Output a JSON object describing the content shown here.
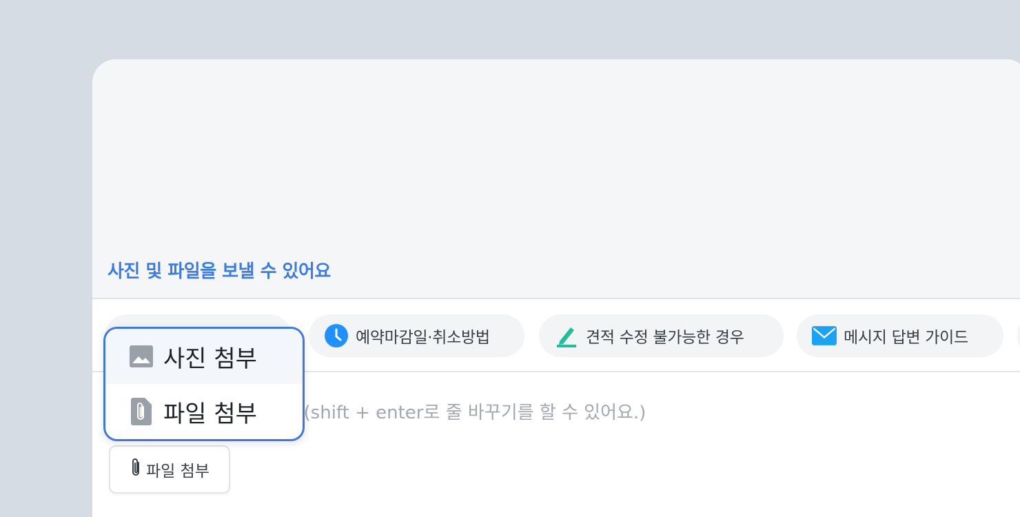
{
  "preview": {
    "hint": "사진 및 파일을 보낼 수 있어요"
  },
  "chips": [
    {
      "label": "",
      "icon": "hidden-icon"
    },
    {
      "label": "예약마감일·취소방법",
      "icon": "clock-icon",
      "color": "#1e90ff"
    },
    {
      "label": "견적 수정 불가능한 경우",
      "icon": "pencil-icon",
      "color": "#1fbf9a"
    },
    {
      "label": "메시지 답변 가이드",
      "icon": "envelope-icon",
      "color": "#1aa3f5"
    }
  ],
  "input": {
    "placeholder": ". (shift + enter로 줄 바꾸기를 할 수 있어요.)"
  },
  "attach_button": {
    "label": "파일 첨부",
    "icon": "paperclip-icon"
  },
  "attach_menu": {
    "items": [
      {
        "label": "사진 첨부",
        "icon": "image-icon"
      },
      {
        "label": "파일 첨부",
        "icon": "file-clip-icon"
      }
    ],
    "border_color": "#3d77e8"
  }
}
